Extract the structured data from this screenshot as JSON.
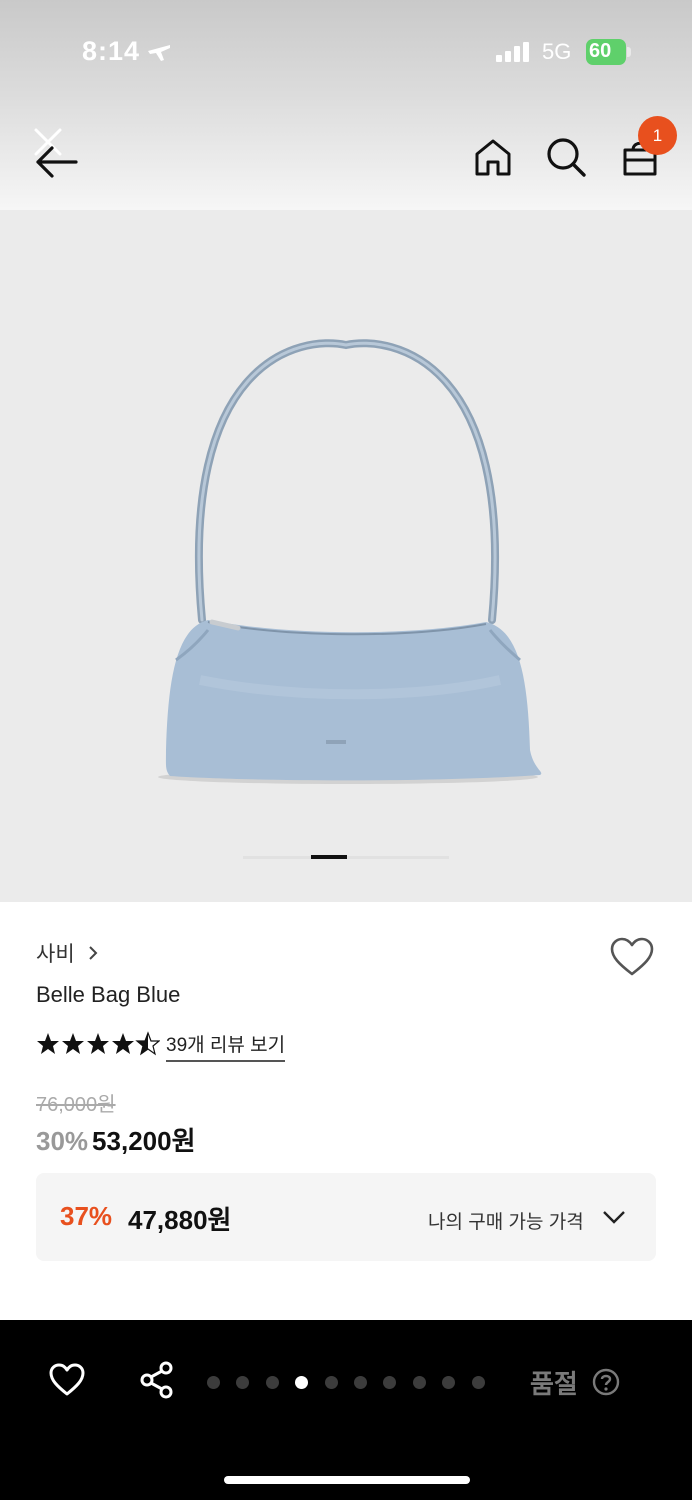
{
  "status_bar": {
    "time": "8:14",
    "network": "5G",
    "battery": "60"
  },
  "header": {
    "cart_badge": "1"
  },
  "gallery": {
    "current_index": 3
  },
  "product": {
    "brand": "사비",
    "name": "Belle Bag Blue",
    "rating": 4.5,
    "review_link": "39개 리뷰 보기",
    "original_price": "76,000원",
    "discount_percent": "30%",
    "sale_price": "53,200원",
    "my_price": {
      "discount_percent": "37%",
      "price": "47,880원",
      "label": "나의 구매 가능 가격"
    }
  },
  "bottom_bar": {
    "page_dots": 10,
    "active_dot": 3,
    "status": "품절"
  },
  "colors": {
    "accent": "#e8501e",
    "battery": "#5fd06b",
    "bag": "#a7bdd4"
  }
}
